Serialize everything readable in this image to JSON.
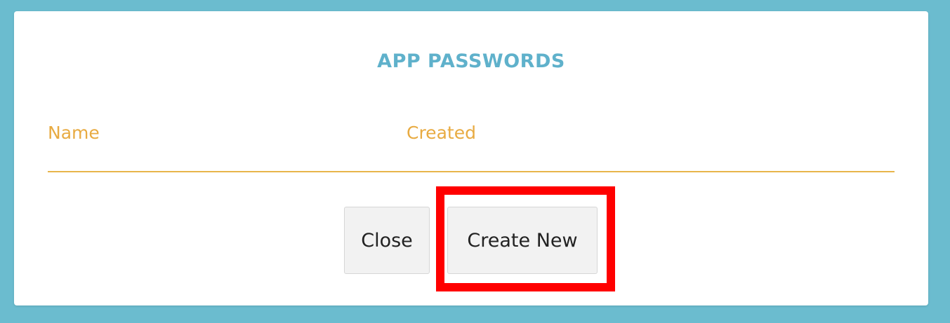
{
  "dialog": {
    "title": "APP PASSWORDS",
    "columns": [
      "Name",
      "Created"
    ],
    "buttons": {
      "close_label": "Close",
      "create_label": "Create New"
    }
  },
  "colors": {
    "backdrop": "#6bbccf",
    "title": "#5fb1cb",
    "column_header": "#e8ab42",
    "highlight": "#ff0000"
  }
}
